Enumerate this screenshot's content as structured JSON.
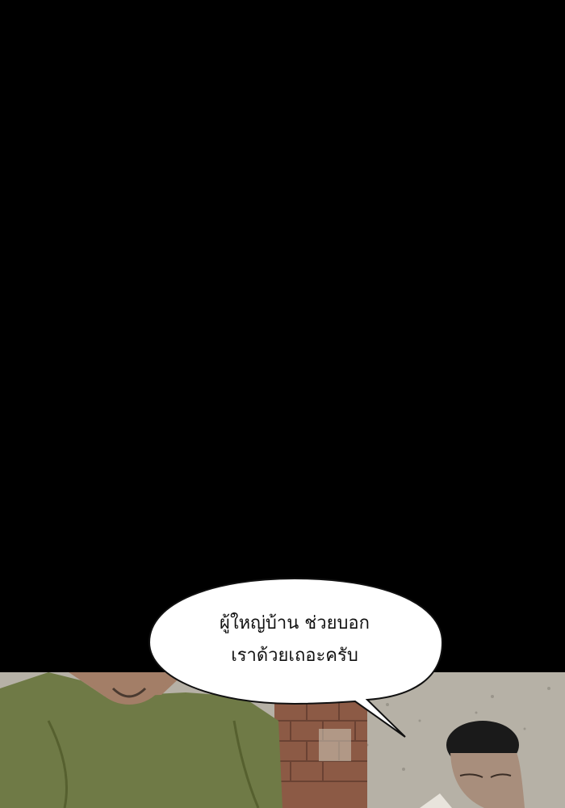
{
  "speech_bubble": {
    "line1": "ผู้ใหญ่บ้าน ช่วยบอก",
    "line2": "เราด้วยเถอะครับ"
  },
  "colors": {
    "background": "#000000",
    "bubble_fill": "#ffffff",
    "bubble_stroke": "#111111",
    "shirt_green": "#6f7a46",
    "skin": "#a37e67",
    "brick": "#8c5a45",
    "ground": "#b6b1a6"
  }
}
